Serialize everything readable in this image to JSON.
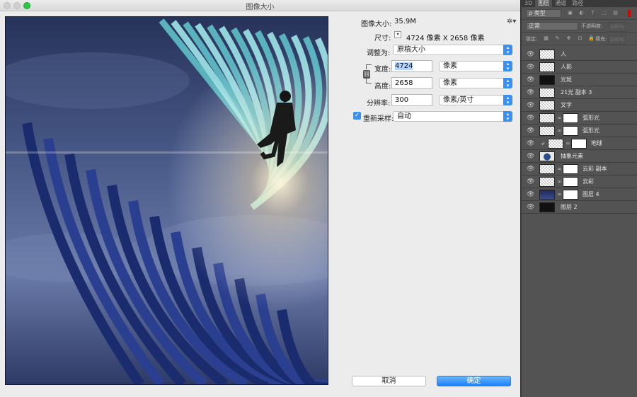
{
  "dialog": {
    "title": "图像大小",
    "image_size_label": "图像大小:",
    "image_size_value": "35.9M",
    "dimensions_label": "尺寸:",
    "dimensions_value": "4724 像素  X  2658 像素",
    "fit_label": "调整为:",
    "fit_value": "原稿大小",
    "width_label": "宽度:",
    "width_value": "4724",
    "width_unit": "像素",
    "height_label": "高度:",
    "height_value": "2658",
    "height_unit": "像素",
    "resolution_label": "分辨率:",
    "resolution_value": "300",
    "resolution_unit": "像素/英寸",
    "resample_label": "重新采样:",
    "resample_value": "自动",
    "cancel_label": "取消",
    "ok_label": "确定"
  },
  "panel": {
    "tabs": [
      "3D",
      "图层",
      "通道",
      "路径"
    ],
    "active_tab": "图层",
    "filter_kind": "ρ 类型",
    "blend_mode": "正常",
    "opacity_label": "不透明度:",
    "opacity_value": "100%",
    "lock_label": "锁定:",
    "fill_label": "填充:",
    "fill_value": "100%",
    "layers": [
      {
        "name": "人",
        "thumb": "transparent",
        "mask": false
      },
      {
        "name": "人影",
        "thumb": "transparent",
        "mask": false
      },
      {
        "name": "光斑",
        "thumb": "dark",
        "mask": false
      },
      {
        "name": "21光 副本 3",
        "thumb": "transparent",
        "mask": false
      },
      {
        "name": "文字",
        "thumb": "transparent",
        "mask": false
      },
      {
        "name": "弧形光",
        "thumb": "transparent",
        "mask": true
      },
      {
        "name": "弧形光",
        "thumb": "transparent",
        "mask": true
      },
      {
        "name": "地球",
        "thumb": "transparent",
        "mask": true
      },
      {
        "name": "抽象元素",
        "thumb": "globe",
        "mask": false
      },
      {
        "name": "云彩 副本",
        "thumb": "transparent",
        "mask": true
      },
      {
        "name": "云彩",
        "thumb": "transparent",
        "mask": true
      },
      {
        "name": "图层 4",
        "thumb": "blue",
        "mask": true
      },
      {
        "name": "图层 2",
        "thumb": "dark",
        "mask": false
      }
    ]
  },
  "colors": {
    "accent": "#3a8ff2",
    "dialog_bg": "#ececec",
    "panel_bg": "#535353"
  },
  "icons": [
    "gear-icon",
    "chain-link-icon",
    "eye-icon",
    "checkbox-icon"
  ]
}
